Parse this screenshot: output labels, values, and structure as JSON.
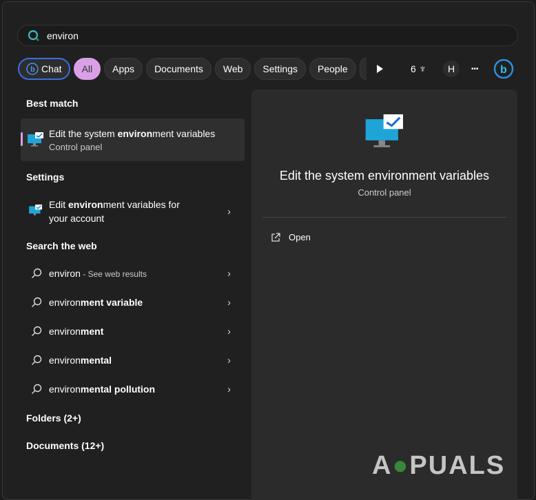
{
  "search": {
    "value": "environ",
    "icon": "search-icon"
  },
  "filters": [
    "Chat",
    "All",
    "Apps",
    "Documents",
    "Web",
    "Settings",
    "People"
  ],
  "active_filter": "All",
  "toolbar": {
    "play_icon": "play-icon",
    "points": "6",
    "rewards_icon": "trophy-icon",
    "avatar": "H",
    "more": "•••",
    "bing_icon": "bing-icon"
  },
  "left": {
    "best_match_heading": "Best match",
    "best_match": {
      "pre": "Edit the system ",
      "bold": "environ",
      "post": "ment variables",
      "sub": "Control panel"
    },
    "settings_heading": "Settings",
    "settings_item": {
      "pre": "Edit ",
      "bold": "environ",
      "post": "ment variables for",
      "line2": "your account"
    },
    "web_heading": "Search the web",
    "web_items": [
      {
        "plain": "environ",
        "bold": "",
        "suffix": " - See web results"
      },
      {
        "plain": "environ",
        "bold": "ment variable",
        "suffix": ""
      },
      {
        "plain": "environ",
        "bold": "ment",
        "suffix": ""
      },
      {
        "plain": "environ",
        "bold": "mental",
        "suffix": ""
      },
      {
        "plain": "environ",
        "bold": "mental pollution",
        "suffix": ""
      }
    ],
    "folders_heading": "Folders (2+)",
    "documents_heading": "Documents (12+)"
  },
  "preview": {
    "title": "Edit the system environment variables",
    "sub": "Control panel",
    "open_label": "Open"
  },
  "colors": {
    "accent": "#d9a0e6",
    "chat_border": "#3a6fe0",
    "panel": "#2b2b2b"
  },
  "watermark": "APPUALS"
}
